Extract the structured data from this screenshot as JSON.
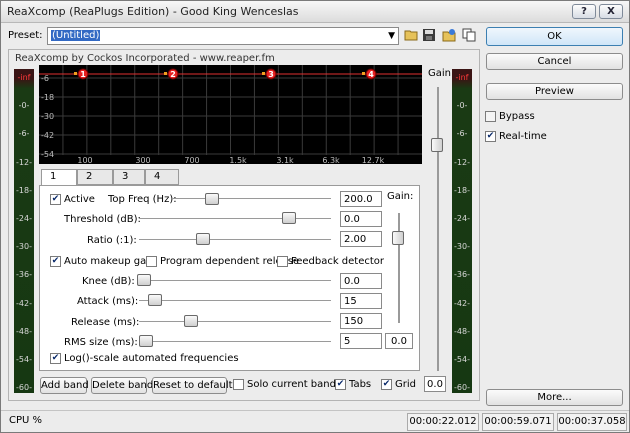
{
  "window": {
    "title": "ReaXcomp (ReaPlugs Edition) - Good King Wenceslas",
    "help_label": "?",
    "close_label": "X"
  },
  "preset": {
    "label": "Preset:",
    "value": "(Untitled)"
  },
  "buttons": {
    "ok": "OK",
    "cancel": "Cancel",
    "preview": "Preview",
    "more": "More..."
  },
  "checks": {
    "bypass": "Bypass",
    "realtime": "Real-time"
  },
  "plugin": {
    "header": "ReaXcomp by Cockos Incorporated - www.reaper.fm",
    "gain_label": "Gain:",
    "meter_labels": [
      "-inf",
      "-0-",
      "-6-",
      "-12-",
      "-18-",
      "-24-",
      "-30-",
      "-36-",
      "-42-",
      "-48-",
      "-54-",
      "-60-"
    ],
    "graph": {
      "y_labels": [
        "-6",
        "-18",
        "-30",
        "-42",
        "-54"
      ],
      "x_labels": [
        "100",
        "300",
        "700",
        "1.5k",
        "3.1k",
        "6.3k",
        "12.7k"
      ],
      "band_markers": [
        "1",
        "2",
        "3",
        "4"
      ]
    },
    "tabs": [
      "1",
      "2",
      "3",
      "4"
    ],
    "band": {
      "active_label": "Active",
      "top_freq_label": "Top Freq (Hz):",
      "top_freq_value": "200.0",
      "threshold_label": "Threshold (dB):",
      "threshold_value": "0.0",
      "ratio_label": "Ratio (:1):",
      "ratio_value": "2.00",
      "auto_makeup_label": "Auto makeup gain",
      "program_dep_label": "Program dependent release",
      "feedback_label": "Feedback detector",
      "knee_label": "Knee (dB):",
      "knee_value": "0.0",
      "attack_label": "Attack (ms):",
      "attack_value": "15",
      "release_label": "Release (ms):",
      "release_value": "150",
      "rms_label": "RMS size (ms):",
      "rms_value": "5",
      "log_scale_label": "Log()-scale automated frequencies",
      "gain_label": "Gain:",
      "gain_value": "0.0"
    },
    "bottom": {
      "add_band": "Add band",
      "delete_band": "Delete band",
      "reset": "Reset to defaults",
      "solo": "Solo current band",
      "tabs": "Tabs",
      "grid": "Grid",
      "gain_value": "0.0"
    }
  },
  "status": {
    "cpu": "CPU %",
    "times": [
      "00:00:22.012",
      "00:00:59.071",
      "00:00:37.058"
    ]
  }
}
